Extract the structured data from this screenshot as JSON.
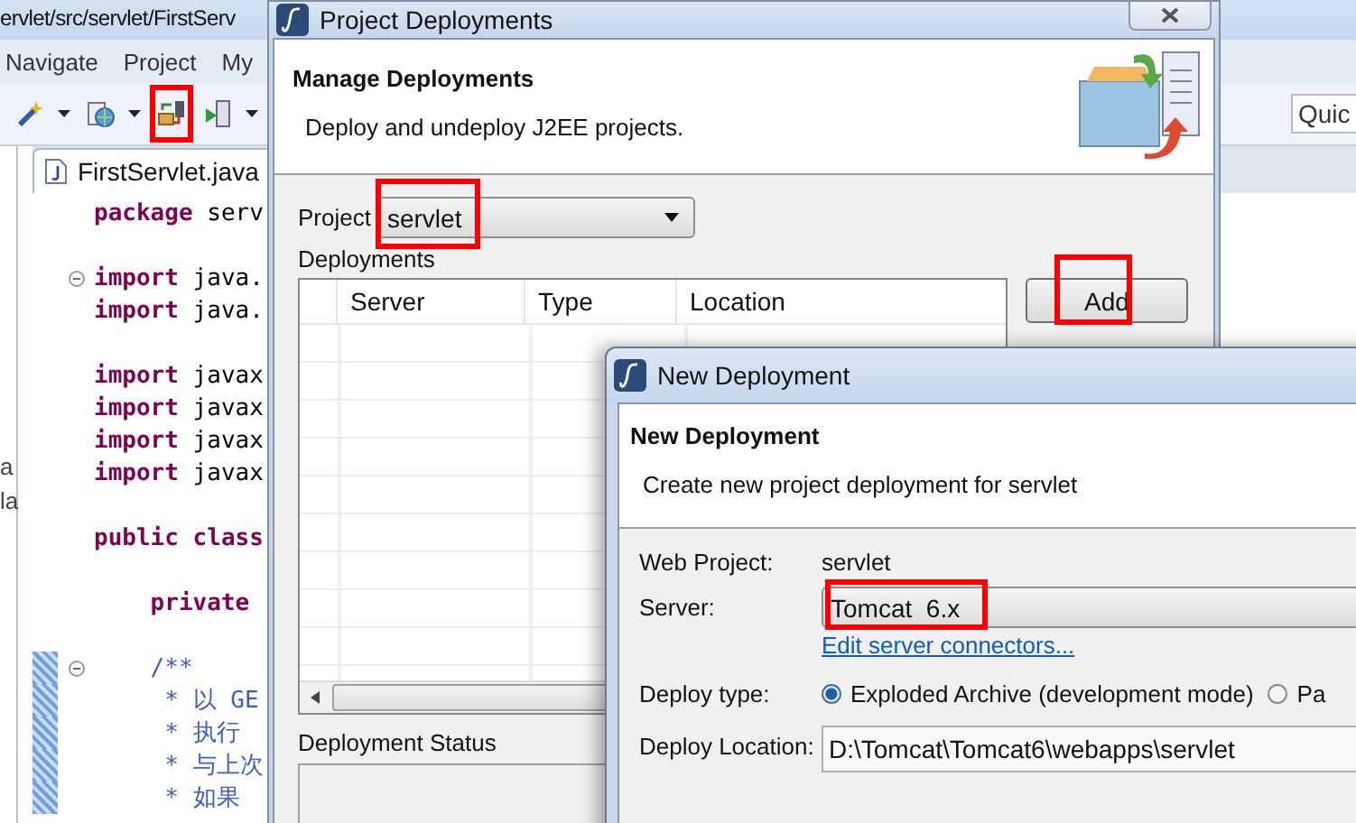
{
  "ide": {
    "title": "ervlet/src/servlet/FirstServ",
    "menu": [
      "Navigate",
      "Project",
      "My"
    ],
    "toolbar": [
      {
        "kind": "wand",
        "caret": true,
        "highlighted": false
      },
      {
        "kind": "globe",
        "caret": true,
        "highlighted": false
      },
      {
        "kind": "deploy",
        "caret": false,
        "highlighted": true
      },
      {
        "kind": "run",
        "caret": true,
        "highlighted": false
      }
    ],
    "quick_access": {
      "placeholder": "Quic"
    },
    "left_fragments": [
      "a",
      "la"
    ],
    "editor_tab": {
      "label": "FirstServlet.java"
    },
    "code_lines": [
      {
        "tokens": [
          {
            "kind": "keyword",
            "text": "package"
          },
          {
            "kind": "plain",
            "text": " serv"
          }
        ]
      },
      {
        "kind": "blank"
      },
      {
        "fold": true,
        "tokens": [
          {
            "kind": "keyword",
            "text": "import"
          },
          {
            "kind": "plain",
            "text": " java."
          }
        ]
      },
      {
        "tokens": [
          {
            "kind": "keyword",
            "text": "import"
          },
          {
            "kind": "plain",
            "text": " java."
          }
        ]
      },
      {
        "kind": "blank"
      },
      {
        "tokens": [
          {
            "kind": "keyword",
            "text": "import"
          },
          {
            "kind": "plain",
            "text": " javax"
          }
        ]
      },
      {
        "tokens": [
          {
            "kind": "keyword",
            "text": "import"
          },
          {
            "kind": "plain",
            "text": " javax"
          }
        ]
      },
      {
        "tokens": [
          {
            "kind": "keyword",
            "text": "import"
          },
          {
            "kind": "plain",
            "text": " javax"
          }
        ]
      },
      {
        "tokens": [
          {
            "kind": "keyword",
            "text": "import"
          },
          {
            "kind": "plain",
            "text": " javax"
          }
        ]
      },
      {
        "kind": "blank"
      },
      {
        "tokens": [
          {
            "kind": "keyword",
            "text": "public class"
          }
        ]
      },
      {
        "kind": "blank"
      },
      {
        "tokens": [
          {
            "kind": "keyword",
            "text": "    private"
          }
        ]
      },
      {
        "kind": "blank"
      },
      {
        "fold": true,
        "marked": true,
        "tokens": [
          {
            "kind": "comment",
            "text": "    /**"
          }
        ]
      },
      {
        "marked": true,
        "tokens": [
          {
            "kind": "comment",
            "text": "     * 以 GE"
          }
        ]
      },
      {
        "marked": true,
        "tokens": [
          {
            "kind": "comment",
            "text": "     * 执行"
          }
        ]
      },
      {
        "marked": true,
        "tokens": [
          {
            "kind": "comment",
            "text": "     * 与上次"
          }
        ]
      },
      {
        "marked": true,
        "tokens": [
          {
            "kind": "comment",
            "text": "     * 如果"
          }
        ]
      }
    ]
  },
  "deploy_dialog": {
    "title": "Project Deployments",
    "heading": "Manage Deployments",
    "description": "Deploy and undeploy J2EE projects.",
    "project_label": "Project",
    "project": {
      "value": "servlet",
      "highlighted": true
    },
    "deployments_label": "Deployments",
    "columns": [
      "Server",
      "Type",
      "Location"
    ],
    "add_button": {
      "label": "Add",
      "highlighted": true
    },
    "status_label": "Deployment Status"
  },
  "new_dialog": {
    "title": "New Deployment",
    "heading": "New Deployment",
    "description": "Create new project deployment for servlet",
    "fields": [
      {
        "kind": "text",
        "label": "Web Project:",
        "value": "servlet"
      },
      {
        "kind": "select",
        "label": "Server:",
        "value": "Tomcat  6.x",
        "highlighted": true
      },
      {
        "kind": "link",
        "text": "Edit server connectors..."
      },
      {
        "kind": "radio",
        "label": "Deploy type:",
        "options": [
          {
            "label": "Exploded Archive (development mode)",
            "selected": true
          },
          {
            "label": "Pa",
            "selected": false
          }
        ]
      },
      {
        "kind": "input",
        "label": "Deploy Location:",
        "value": "D:\\Tomcat\\Tomcat6\\webapps\\servlet"
      }
    ]
  }
}
